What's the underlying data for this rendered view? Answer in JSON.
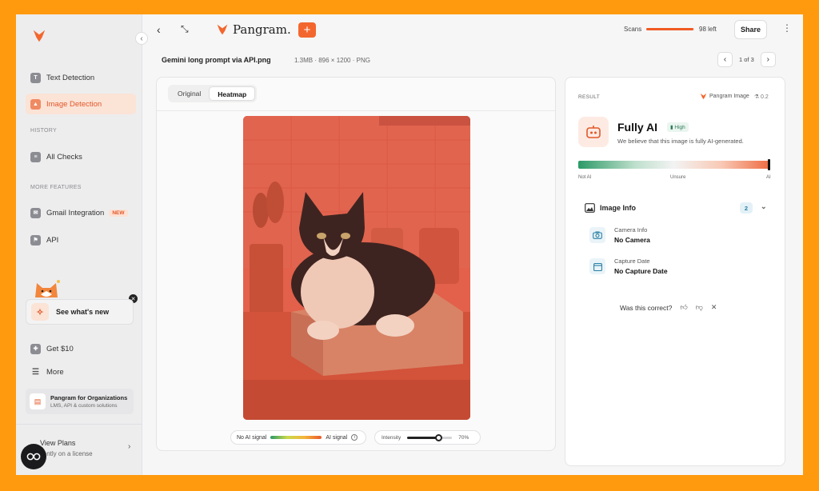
{
  "sidebar": {
    "items": [
      {
        "label": "Text Detection",
        "icon": "text-icon"
      },
      {
        "label": "Image Detection",
        "icon": "image-icon",
        "active": true
      }
    ],
    "history_label": "HISTORY",
    "all_checks": "All Checks",
    "more_label": "MORE FEATURES",
    "gmail": "Gmail Integration",
    "gmail_badge": "NEW",
    "api": "API",
    "whats_new": "See what's new",
    "get10": "Get $10",
    "more": "More",
    "org_title": "Pangram for Organizations",
    "org_sub": "LMS, API & custom solutions",
    "plans_title": "View Plans",
    "plans_sub": "urrently on a license"
  },
  "topbar": {
    "brand": "Pangram.",
    "plus": "+",
    "scans_label": "Scans",
    "scans_left": "98 left",
    "scans_fraction": 0.98,
    "share": "Share"
  },
  "file": {
    "name": "Gemini long prompt via API.png",
    "meta": "1.3MB · 896 × 1200 · PNG",
    "pager": "1 of 3"
  },
  "image_panel": {
    "tabs": [
      "Original",
      "Heatmap"
    ],
    "selected_tab": "Heatmap",
    "legend_left": "No AI signal",
    "legend_right": "AI signal",
    "intensity_label": "Intensity",
    "intensity_value": "70%",
    "intensity_fraction": 0.7
  },
  "result": {
    "label": "RESULT",
    "model": "Pangram Image",
    "version": "0.2",
    "verdict": "Fully AI",
    "confidence": "High",
    "description": "We believe that this image is fully AI-generated.",
    "score_fraction": 0.99,
    "scale": [
      "Not AI",
      "Unsure",
      "AI"
    ],
    "image_info_label": "Image Info",
    "image_info_count": "2",
    "camera_key": "Camera Info",
    "camera_val": "No Camera",
    "date_key": "Capture Date",
    "date_val": "No Capture Date",
    "feedback": "Was this correct?"
  },
  "colors": {
    "accent": "#F3672E",
    "frame": "#FF9A0E",
    "heatmap_overlay": "#E8614A"
  }
}
